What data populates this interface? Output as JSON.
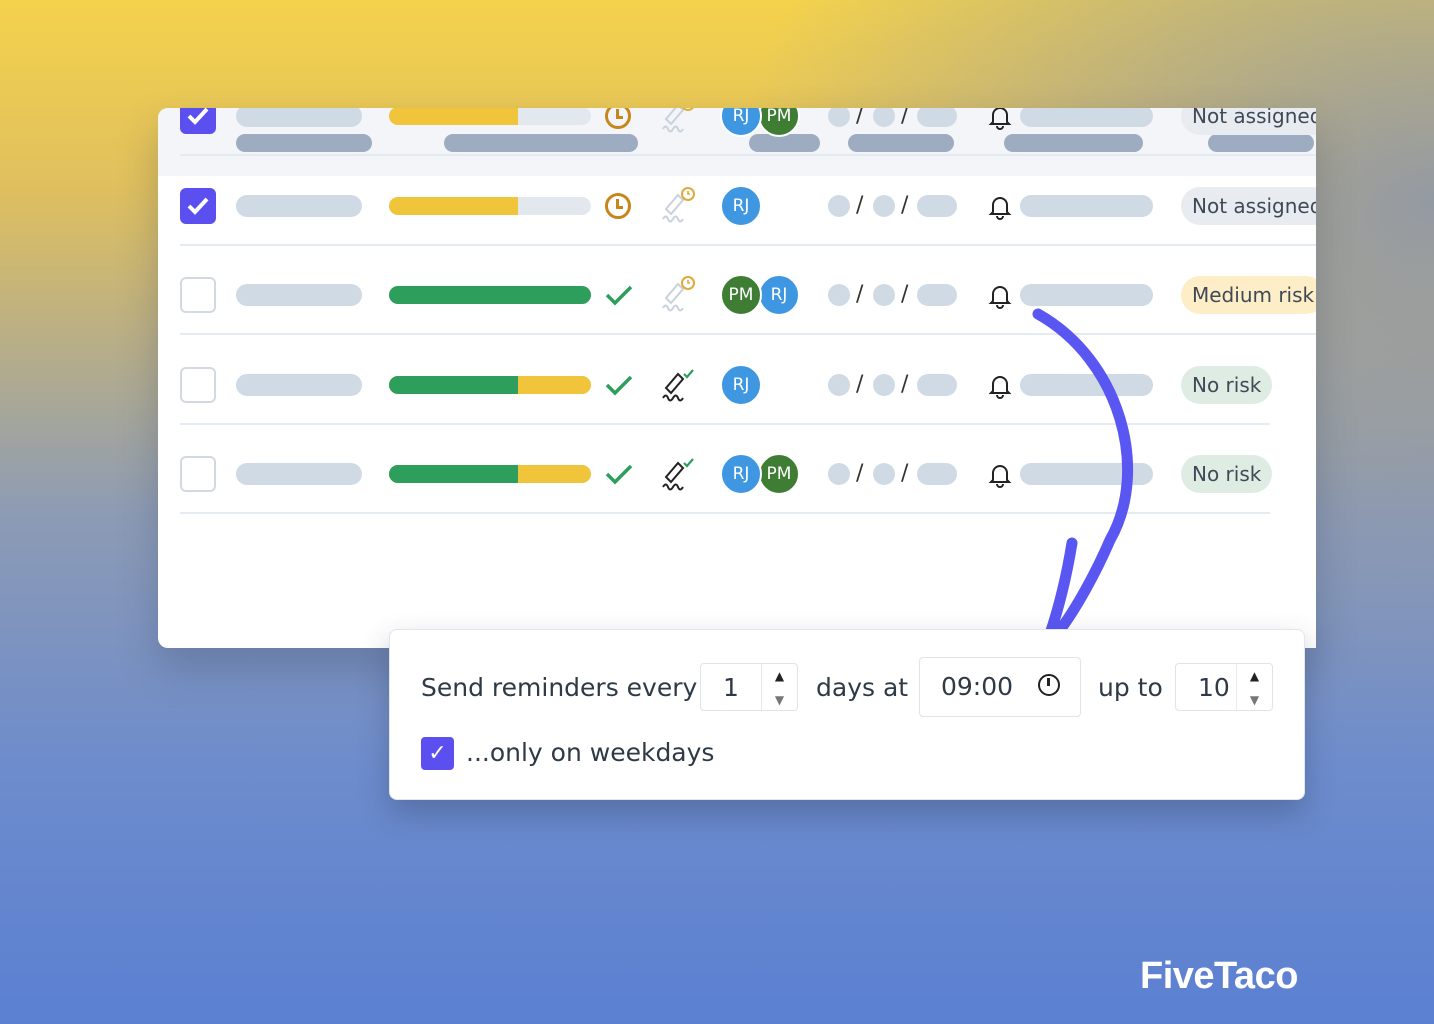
{
  "rows": [
    {
      "checked": true,
      "progress": {
        "yellow": 0.64,
        "green": 0
      },
      "status_icon": "clock-icon",
      "sign_icon": "signature-pending-icon",
      "avatars": [
        "RJ",
        "PM"
      ],
      "badge": "Not assigned",
      "badge_style": "neutral"
    },
    {
      "checked": true,
      "progress": {
        "yellow": 0.64,
        "green": 0
      },
      "status_icon": "clock-icon",
      "sign_icon": "signature-pending-icon",
      "avatars": [
        "RJ"
      ],
      "badge": "Not assigned",
      "badge_style": "neutral"
    },
    {
      "checked": false,
      "progress": {
        "yellow": 0,
        "green": 1
      },
      "status_icon": "check-icon",
      "sign_icon": "signature-pending-icon",
      "avatars": [
        "PM",
        "RJ"
      ],
      "badge": "Medium risk",
      "badge_style": "warning"
    },
    {
      "checked": false,
      "progress": {
        "yellow": 1,
        "green": 0.64
      },
      "status_icon": "check-icon",
      "sign_icon": "signature-done-icon",
      "avatars": [
        "RJ"
      ],
      "badge": "No risk",
      "badge_style": "success"
    },
    {
      "checked": false,
      "progress": {
        "yellow": 1,
        "green": 0.64
      },
      "status_icon": "check-icon",
      "sign_icon": "signature-done-icon",
      "avatars": [
        "RJ",
        "PM"
      ],
      "badge": "No risk",
      "badge_style": "success"
    }
  ],
  "avatar_colors": {
    "RJ": "#3f97e2",
    "PM": "#3f7d34"
  },
  "colors": {
    "accent": "#5b4ff0",
    "yellow": "#f0c53c",
    "green": "#2e9e5c",
    "clock": "#c7861a",
    "neutral_badge": "#e8ecf1",
    "warning_badge": "#fdeec8",
    "success_badge": "#dfece4"
  },
  "reminder": {
    "label_every": "Send reminders every",
    "interval": "1",
    "label_days_at": "days at",
    "time": "09:00",
    "label_up_to": "up to",
    "max": "10",
    "weekdays_checked": true,
    "weekdays_label": "...only on weekdays"
  },
  "brand": "FiveTaco"
}
